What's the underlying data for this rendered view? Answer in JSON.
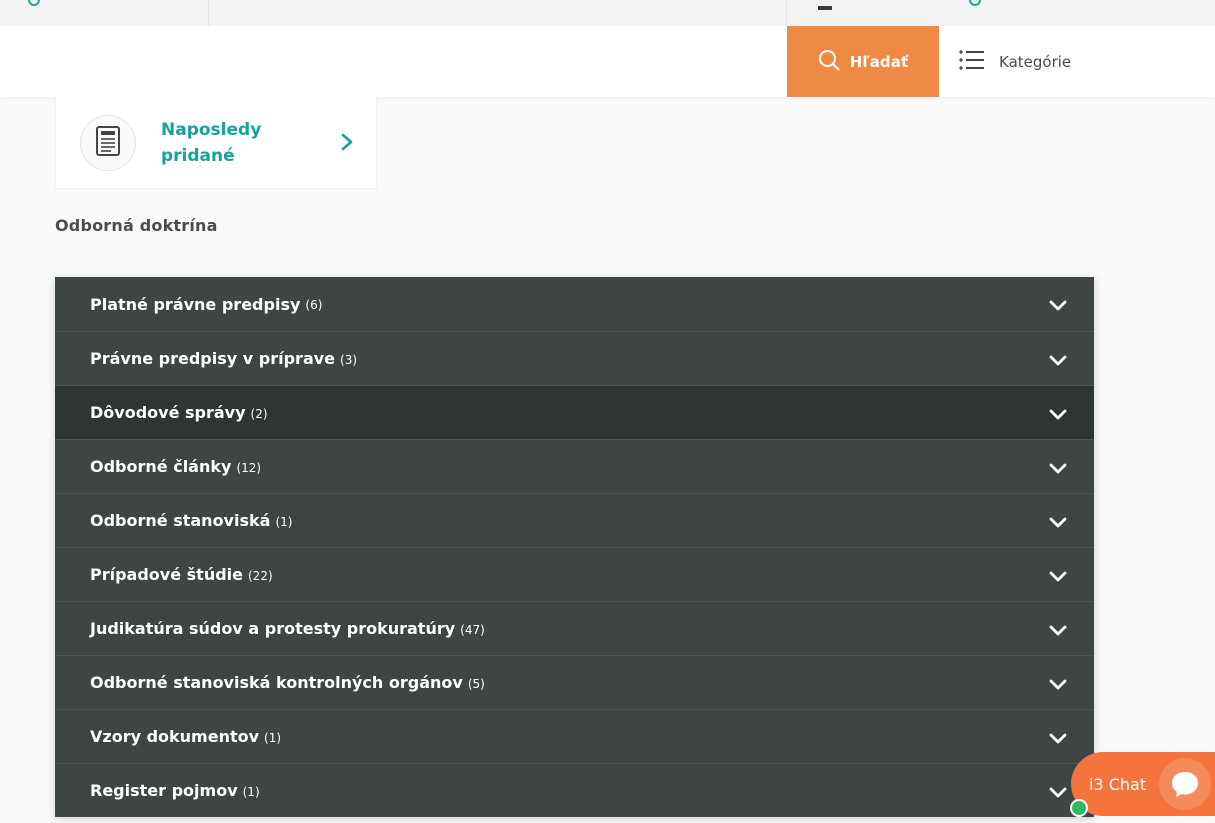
{
  "header": {
    "search_label": "Hľadať",
    "categories_label": "Kategórie"
  },
  "recent": {
    "title": "Naposledy pridané"
  },
  "section_title": "Odborná doktrína",
  "accordion": [
    {
      "name": "Platné právne predpisy",
      "count": "(6)"
    },
    {
      "name": "Právne predpisy v príprave",
      "count": "(3)"
    },
    {
      "name": "Dôvodové správy",
      "count": "(2)"
    },
    {
      "name": "Odborné články",
      "count": "(12)"
    },
    {
      "name": "Odborné stanoviská",
      "count": "(1)"
    },
    {
      "name": "Prípadové štúdie",
      "count": "(22)"
    },
    {
      "name": "Judikatúra súdov a protesty prokuratúry",
      "count": "(47)"
    },
    {
      "name": "Odborné stanoviská kontrolných orgánov",
      "count": "(5)"
    },
    {
      "name": "Vzory dokumentov",
      "count": "(1)"
    },
    {
      "name": "Register pojmov",
      "count": "(1)"
    }
  ],
  "chat": {
    "label": "i3 Chat"
  },
  "colors": {
    "accent_orange": "#ee8a43",
    "teal": "#15a39a",
    "row_bg": "#3f4445",
    "row_active_bg": "#2f3535",
    "chat_orange": "#f5733c"
  },
  "icons": {
    "search": "search-icon",
    "menu": "list-menu-icon",
    "document": "document-icon",
    "arrow": "chevron-right-icon",
    "chevron": "chevron-down-icon",
    "chat": "chat-bubble-icon"
  }
}
